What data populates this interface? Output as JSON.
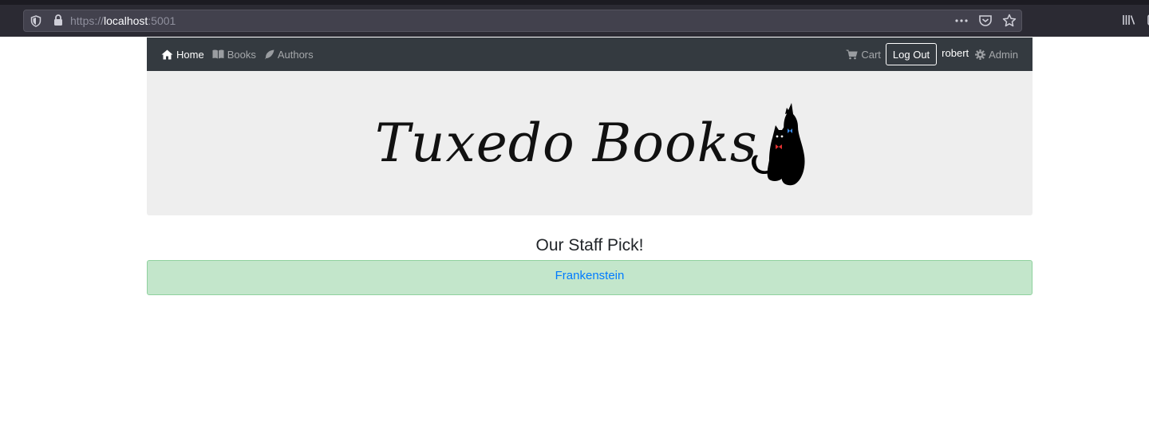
{
  "browser": {
    "url_scheme": "https://",
    "url_host": "localhost",
    "url_port": ":5001",
    "icons": [
      "shield-icon",
      "lock-icon",
      "more-icon",
      "pocket-icon",
      "star-icon",
      "library-icon"
    ]
  },
  "navbar": {
    "links": [
      {
        "label": "Home",
        "icon": "home-icon",
        "active": true
      },
      {
        "label": "Books",
        "icon": "book-icon",
        "active": false
      },
      {
        "label": "Authors",
        "icon": "feather-icon",
        "active": false
      }
    ],
    "cart_label": "Cart",
    "logout_label": "Log Out",
    "username": "robert",
    "admin_label": "Admin",
    "background": "#343a40"
  },
  "banner": {
    "logo_text": "Tuxedo Books",
    "background": "#eeeeee"
  },
  "staff_pick": {
    "heading": "Our Staff Pick!",
    "book_title": "Frankenstein",
    "box_color": "#c3e6cb",
    "link_color": "#007bff"
  }
}
